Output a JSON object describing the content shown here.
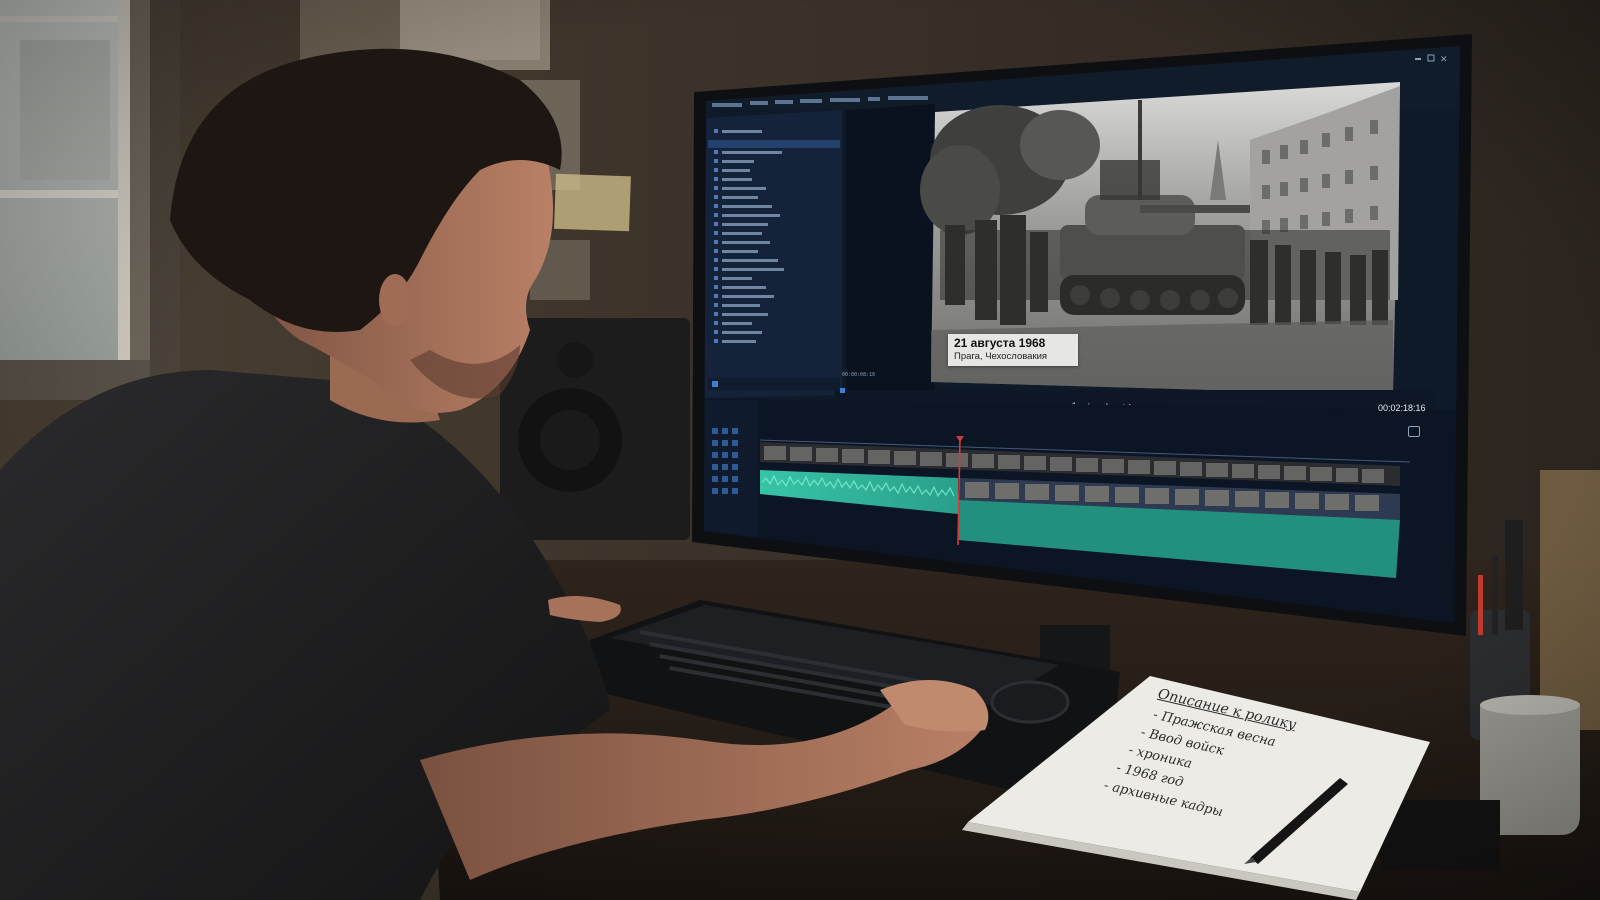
{
  "editor": {
    "title_bar": "",
    "preview": {
      "caption_date": "21 августа 1968",
      "caption_place": "Прага, Чехословакия"
    },
    "timecode": "00:02:18:16",
    "source_timecode": "00:00:08:16"
  },
  "notebook": {
    "title": "Описание к ролику",
    "items": [
      "- Пражская весна",
      "- Ввод войск",
      "- хроника",
      "- 1968 год",
      "- архивные кадры"
    ]
  },
  "colors": {
    "wall": "#3a3128",
    "monitor_bezel": "#0d0f12",
    "ui_background": "#0f1a29",
    "audio_track": "#2a9f8a",
    "playhead": "#d23b3b"
  }
}
